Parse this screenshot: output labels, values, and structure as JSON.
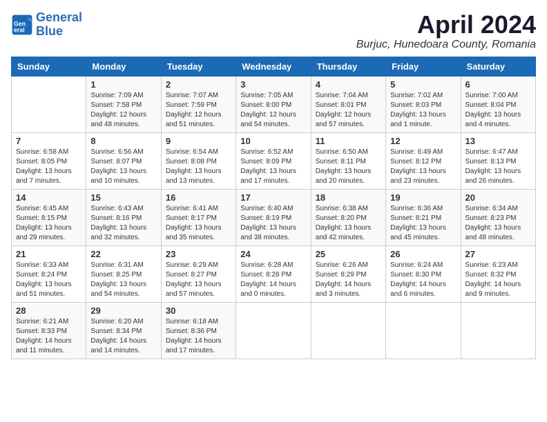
{
  "header": {
    "logo_line1": "General",
    "logo_line2": "Blue",
    "title": "April 2024",
    "subtitle": "Burjuc, Hunedoara County, Romania"
  },
  "days_of_week": [
    "Sunday",
    "Monday",
    "Tuesday",
    "Wednesday",
    "Thursday",
    "Friday",
    "Saturday"
  ],
  "weeks": [
    [
      {
        "day": "",
        "sunrise": "",
        "sunset": "",
        "daylight": ""
      },
      {
        "day": "1",
        "sunrise": "Sunrise: 7:09 AM",
        "sunset": "Sunset: 7:58 PM",
        "daylight": "Daylight: 12 hours and 48 minutes."
      },
      {
        "day": "2",
        "sunrise": "Sunrise: 7:07 AM",
        "sunset": "Sunset: 7:59 PM",
        "daylight": "Daylight: 12 hours and 51 minutes."
      },
      {
        "day": "3",
        "sunrise": "Sunrise: 7:05 AM",
        "sunset": "Sunset: 8:00 PM",
        "daylight": "Daylight: 12 hours and 54 minutes."
      },
      {
        "day": "4",
        "sunrise": "Sunrise: 7:04 AM",
        "sunset": "Sunset: 8:01 PM",
        "daylight": "Daylight: 12 hours and 57 minutes."
      },
      {
        "day": "5",
        "sunrise": "Sunrise: 7:02 AM",
        "sunset": "Sunset: 8:03 PM",
        "daylight": "Daylight: 13 hours and 1 minute."
      },
      {
        "day": "6",
        "sunrise": "Sunrise: 7:00 AM",
        "sunset": "Sunset: 8:04 PM",
        "daylight": "Daylight: 13 hours and 4 minutes."
      }
    ],
    [
      {
        "day": "7",
        "sunrise": "Sunrise: 6:58 AM",
        "sunset": "Sunset: 8:05 PM",
        "daylight": "Daylight: 13 hours and 7 minutes."
      },
      {
        "day": "8",
        "sunrise": "Sunrise: 6:56 AM",
        "sunset": "Sunset: 8:07 PM",
        "daylight": "Daylight: 13 hours and 10 minutes."
      },
      {
        "day": "9",
        "sunrise": "Sunrise: 6:54 AM",
        "sunset": "Sunset: 8:08 PM",
        "daylight": "Daylight: 13 hours and 13 minutes."
      },
      {
        "day": "10",
        "sunrise": "Sunrise: 6:52 AM",
        "sunset": "Sunset: 8:09 PM",
        "daylight": "Daylight: 13 hours and 17 minutes."
      },
      {
        "day": "11",
        "sunrise": "Sunrise: 6:50 AM",
        "sunset": "Sunset: 8:11 PM",
        "daylight": "Daylight: 13 hours and 20 minutes."
      },
      {
        "day": "12",
        "sunrise": "Sunrise: 6:49 AM",
        "sunset": "Sunset: 8:12 PM",
        "daylight": "Daylight: 13 hours and 23 minutes."
      },
      {
        "day": "13",
        "sunrise": "Sunrise: 6:47 AM",
        "sunset": "Sunset: 8:13 PM",
        "daylight": "Daylight: 13 hours and 26 minutes."
      }
    ],
    [
      {
        "day": "14",
        "sunrise": "Sunrise: 6:45 AM",
        "sunset": "Sunset: 8:15 PM",
        "daylight": "Daylight: 13 hours and 29 minutes."
      },
      {
        "day": "15",
        "sunrise": "Sunrise: 6:43 AM",
        "sunset": "Sunset: 8:16 PM",
        "daylight": "Daylight: 13 hours and 32 minutes."
      },
      {
        "day": "16",
        "sunrise": "Sunrise: 6:41 AM",
        "sunset": "Sunset: 8:17 PM",
        "daylight": "Daylight: 13 hours and 35 minutes."
      },
      {
        "day": "17",
        "sunrise": "Sunrise: 6:40 AM",
        "sunset": "Sunset: 8:19 PM",
        "daylight": "Daylight: 13 hours and 38 minutes."
      },
      {
        "day": "18",
        "sunrise": "Sunrise: 6:38 AM",
        "sunset": "Sunset: 8:20 PM",
        "daylight": "Daylight: 13 hours and 42 minutes."
      },
      {
        "day": "19",
        "sunrise": "Sunrise: 6:36 AM",
        "sunset": "Sunset: 8:21 PM",
        "daylight": "Daylight: 13 hours and 45 minutes."
      },
      {
        "day": "20",
        "sunrise": "Sunrise: 6:34 AM",
        "sunset": "Sunset: 8:23 PM",
        "daylight": "Daylight: 13 hours and 48 minutes."
      }
    ],
    [
      {
        "day": "21",
        "sunrise": "Sunrise: 6:33 AM",
        "sunset": "Sunset: 8:24 PM",
        "daylight": "Daylight: 13 hours and 51 minutes."
      },
      {
        "day": "22",
        "sunrise": "Sunrise: 6:31 AM",
        "sunset": "Sunset: 8:25 PM",
        "daylight": "Daylight: 13 hours and 54 minutes."
      },
      {
        "day": "23",
        "sunrise": "Sunrise: 6:29 AM",
        "sunset": "Sunset: 8:27 PM",
        "daylight": "Daylight: 13 hours and 57 minutes."
      },
      {
        "day": "24",
        "sunrise": "Sunrise: 6:28 AM",
        "sunset": "Sunset: 8:28 PM",
        "daylight": "Daylight: 14 hours and 0 minutes."
      },
      {
        "day": "25",
        "sunrise": "Sunrise: 6:26 AM",
        "sunset": "Sunset: 8:29 PM",
        "daylight": "Daylight: 14 hours and 3 minutes."
      },
      {
        "day": "26",
        "sunrise": "Sunrise: 6:24 AM",
        "sunset": "Sunset: 8:30 PM",
        "daylight": "Daylight: 14 hours and 6 minutes."
      },
      {
        "day": "27",
        "sunrise": "Sunrise: 6:23 AM",
        "sunset": "Sunset: 8:32 PM",
        "daylight": "Daylight: 14 hours and 9 minutes."
      }
    ],
    [
      {
        "day": "28",
        "sunrise": "Sunrise: 6:21 AM",
        "sunset": "Sunset: 8:33 PM",
        "daylight": "Daylight: 14 hours and 11 minutes."
      },
      {
        "day": "29",
        "sunrise": "Sunrise: 6:20 AM",
        "sunset": "Sunset: 8:34 PM",
        "daylight": "Daylight: 14 hours and 14 minutes."
      },
      {
        "day": "30",
        "sunrise": "Sunrise: 6:18 AM",
        "sunset": "Sunset: 8:36 PM",
        "daylight": "Daylight: 14 hours and 17 minutes."
      },
      {
        "day": "",
        "sunrise": "",
        "sunset": "",
        "daylight": ""
      },
      {
        "day": "",
        "sunrise": "",
        "sunset": "",
        "daylight": ""
      },
      {
        "day": "",
        "sunrise": "",
        "sunset": "",
        "daylight": ""
      },
      {
        "day": "",
        "sunrise": "",
        "sunset": "",
        "daylight": ""
      }
    ]
  ]
}
